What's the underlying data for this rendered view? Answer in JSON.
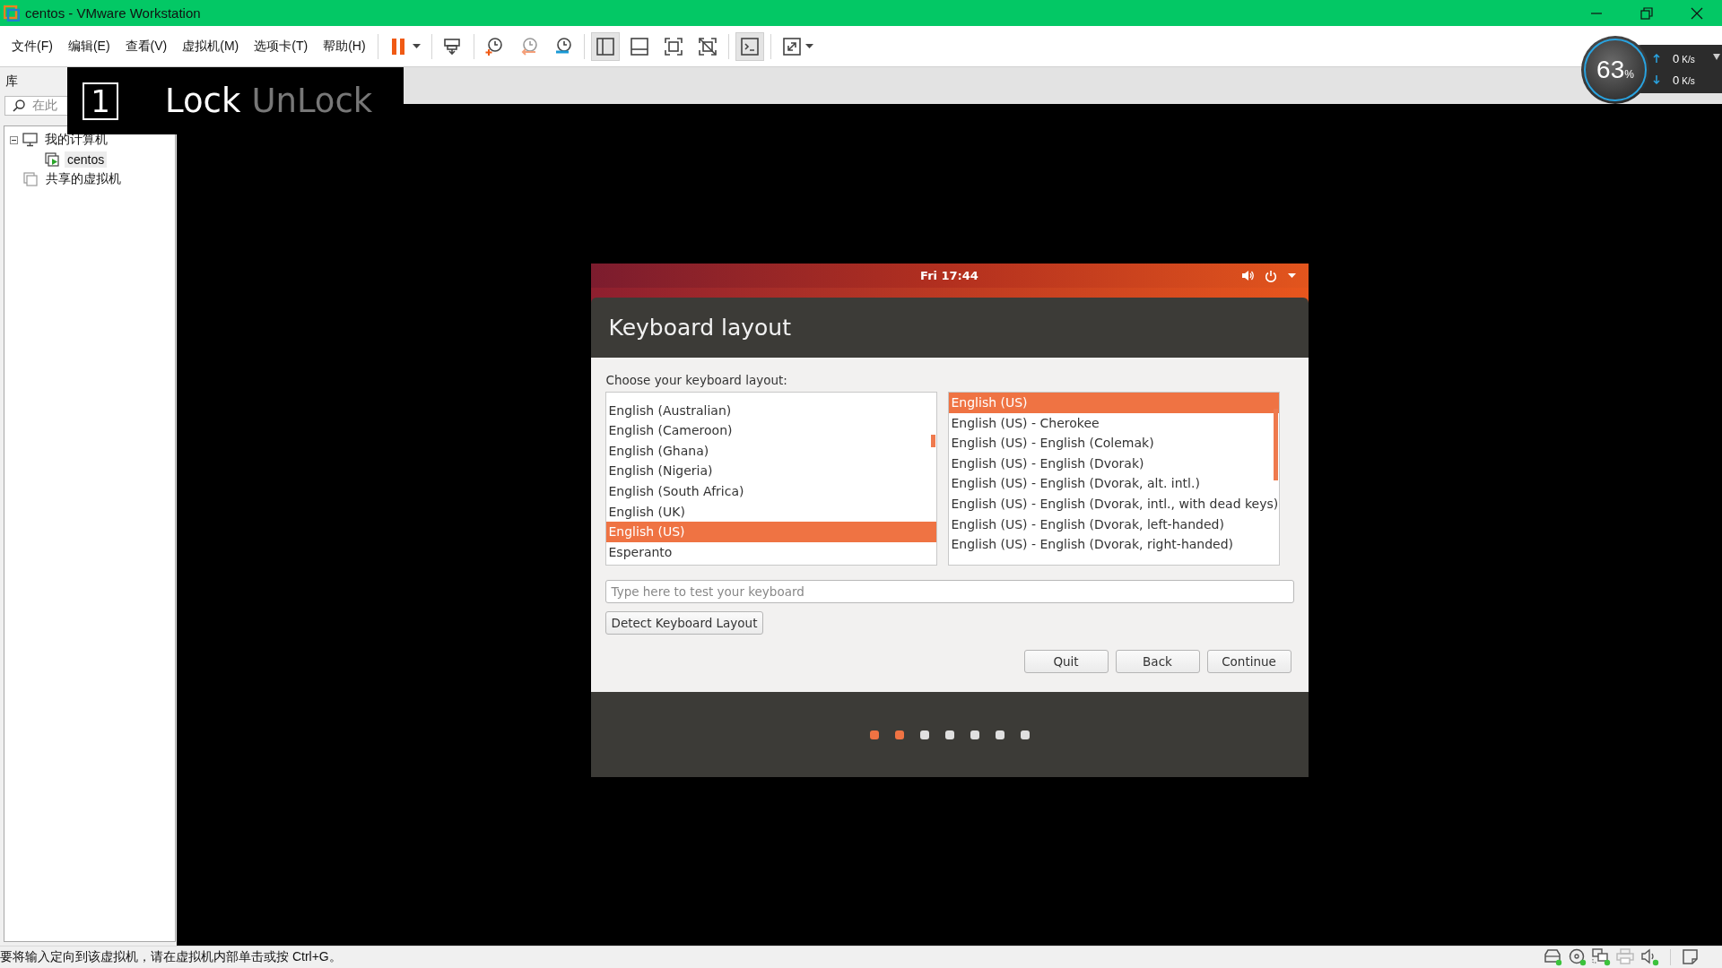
{
  "window": {
    "title": "centos - VMware Workstation"
  },
  "menu": [
    "文件(F)",
    "编辑(E)",
    "查看(V)",
    "虚拟机(M)",
    "选项卡(T)",
    "帮助(H)"
  ],
  "toolbar": {
    "groups": [
      [
        {
          "kind": "pause",
          "on": false,
          "menu": true
        }
      ],
      [
        {
          "kind": "send_keys",
          "on": false,
          "menu": false
        }
      ],
      [
        {
          "kind": "snapshot_take",
          "on": false,
          "menu": false
        },
        {
          "kind": "snapshot_revert",
          "on": false,
          "menu": false
        },
        {
          "kind": "snapshot_manager",
          "on": false,
          "menu": false
        }
      ],
      [
        {
          "kind": "library",
          "on": true,
          "menu": false
        },
        {
          "kind": "thumbnails",
          "on": false,
          "menu": false
        },
        {
          "kind": "full_screen",
          "on": false,
          "menu": false
        },
        {
          "kind": "unity",
          "on": false,
          "menu": false
        }
      ],
      [
        {
          "kind": "console",
          "on": true,
          "menu": false
        }
      ],
      [
        {
          "kind": "stretch",
          "on": false,
          "menu": true
        }
      ]
    ]
  },
  "sidebar": {
    "title": "库",
    "search": {
      "placeholder": "在此"
    },
    "tree": [
      {
        "label": "我的计算机",
        "kind": "computer",
        "selected": false,
        "expanded": true,
        "children": [
          {
            "label": "centos",
            "kind": "vm",
            "selected": true
          }
        ]
      },
      {
        "label": "共享的虚拟机",
        "kind": "shared",
        "selected": false
      }
    ]
  },
  "lock_overlay": {
    "badge": "1",
    "options": [
      {
        "label": "Lock",
        "active": true
      },
      {
        "label": "UnLock",
        "active": false
      }
    ]
  },
  "monitor": {
    "value": "63",
    "unit": "%",
    "rates": [
      {
        "kind": "up",
        "value": "0",
        "unit": "K/s"
      },
      {
        "kind": "down",
        "value": "0",
        "unit": "K/s"
      }
    ]
  },
  "installer": {
    "topbar": {
      "clock": "Fri 17:44"
    },
    "title": "Keyboard layout",
    "prompt": "Choose your keyboard layout:",
    "layouts": [
      {
        "label": "English (Australian)",
        "selected": false
      },
      {
        "label": "English (Cameroon)",
        "selected": false
      },
      {
        "label": "English (Ghana)",
        "selected": false
      },
      {
        "label": "English (Nigeria)",
        "selected": false
      },
      {
        "label": "English (South Africa)",
        "selected": false
      },
      {
        "label": "English (UK)",
        "selected": false
      },
      {
        "label": "English (US)",
        "selected": true
      },
      {
        "label": "Esperanto",
        "selected": false
      }
    ],
    "variants": [
      {
        "label": "English (US)",
        "selected": true
      },
      {
        "label": "English (US) - Cherokee",
        "selected": false
      },
      {
        "label": "English (US) - English (Colemak)",
        "selected": false
      },
      {
        "label": "English (US) - English (Dvorak)",
        "selected": false
      },
      {
        "label": "English (US) - English (Dvorak, alt. intl.)",
        "selected": false
      },
      {
        "label": "English (US) - English (Dvorak, intl., with dead keys)",
        "selected": false
      },
      {
        "label": "English (US) - English (Dvorak, left-handed)",
        "selected": false
      },
      {
        "label": "English (US) - English (Dvorak, right-handed)",
        "selected": false
      }
    ],
    "test_field": {
      "placeholder": "Type here to test your keyboard"
    },
    "detect_button": "Detect Keyboard Layout",
    "buttons": [
      "Quit",
      "Back",
      "Continue"
    ],
    "steps": [
      {
        "done": true
      },
      {
        "done": true
      },
      {
        "done": false
      },
      {
        "done": false
      },
      {
        "done": false
      },
      {
        "done": false
      },
      {
        "done": false
      }
    ]
  },
  "status_bar": {
    "message": "要将输入定向到该虚拟机，请在虚拟机内部单击或按 Ctrl+G。",
    "devices": [
      {
        "kind": "disk",
        "connected": true,
        "disabled": false
      },
      {
        "kind": "cd",
        "connected": true,
        "disabled": false
      },
      {
        "kind": "network",
        "connected": true,
        "disabled": false
      },
      {
        "kind": "printer",
        "connected": false,
        "disabled": true
      },
      {
        "kind": "sound",
        "connected": true,
        "disabled": false
      },
      {
        "kind": "message",
        "connected": false,
        "disabled": false
      }
    ]
  }
}
